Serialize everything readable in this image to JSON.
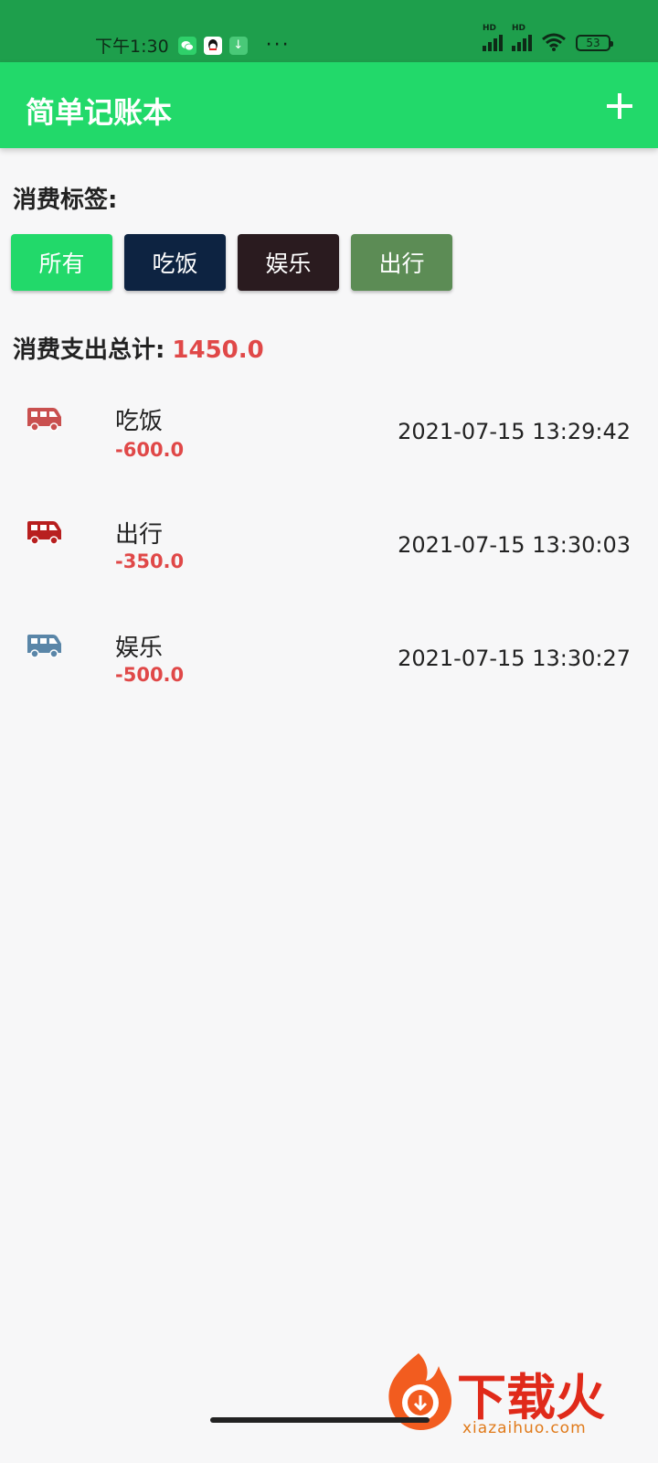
{
  "status_bar": {
    "time": "下午1:30",
    "battery": "53",
    "dots": "···"
  },
  "app": {
    "title": "简单记账本"
  },
  "tags": {
    "label": "消费标签:",
    "items": [
      "所有",
      "吃饭",
      "娱乐",
      "出行"
    ]
  },
  "summary": {
    "label": "消费支出总计:",
    "total": "1450.0"
  },
  "records": [
    {
      "name": "吃饭",
      "amount": "-600.0",
      "time": "2021-07-15 13:29:42",
      "icon": "van-icon",
      "icon_color": "#c9504f"
    },
    {
      "name": "出行",
      "amount": "-350.0",
      "time": "2021-07-15 13:30:03",
      "icon": "van-icon",
      "icon_color": "#b81f1f"
    },
    {
      "name": "娱乐",
      "amount": "-500.0",
      "time": "2021-07-15 13:30:27",
      "icon": "van-icon",
      "icon_color": "#5a86a8"
    }
  ],
  "watermark": {
    "text": "下载火",
    "sub": "xiazaihuo.com"
  },
  "colors": {
    "status_bar": "#1e9f4c",
    "app_bar": "#22d96a",
    "amount": "#e04848"
  }
}
